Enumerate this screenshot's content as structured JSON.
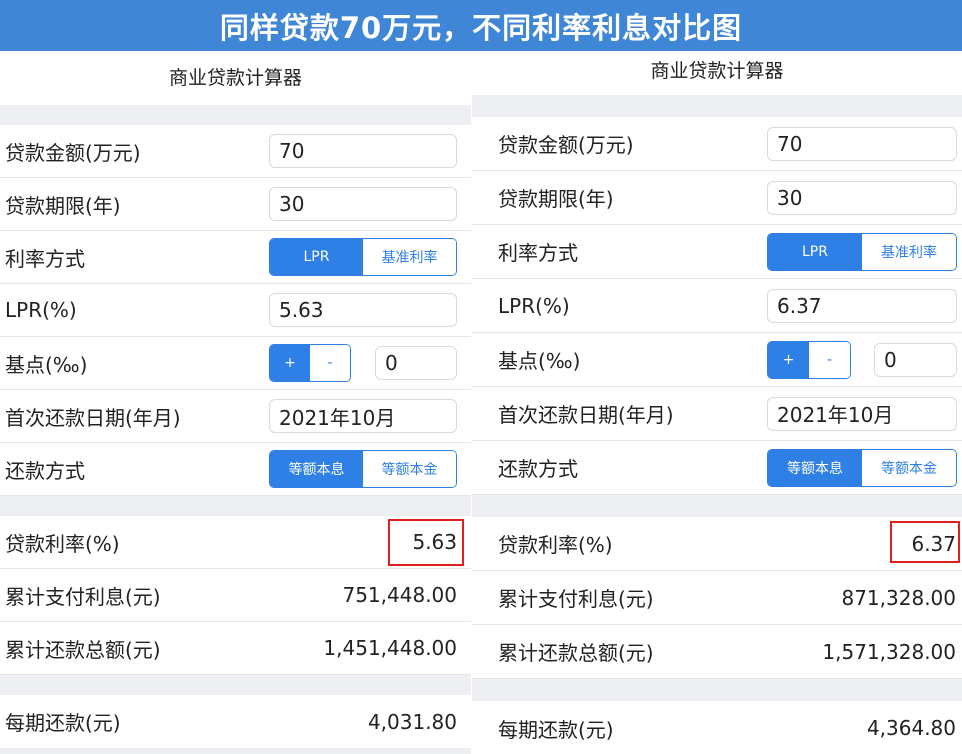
{
  "banner": {
    "title": "同样贷款70万元，不同利率利息对比图"
  },
  "calculators": [
    {
      "title": "商业贷款计算器",
      "loan_amount": {
        "label": "贷款金额(万元)",
        "value": "70"
      },
      "loan_term": {
        "label": "贷款期限(年)",
        "value": "30"
      },
      "rate_mode": {
        "label": "利率方式",
        "options": [
          "LPR",
          "基准利率"
        ],
        "selected": "LPR"
      },
      "lpr": {
        "label": "LPR(%)",
        "value": "5.63"
      },
      "basis_points": {
        "label": "基点(‰)",
        "plus": "+",
        "minus": "-",
        "value": "0"
      },
      "first_payment": {
        "label": "首次还款日期(年月)",
        "value": "2021年10月"
      },
      "repay_method": {
        "label": "还款方式",
        "options": [
          "等额本息",
          "等额本金"
        ],
        "selected": "等额本息"
      },
      "results": {
        "rate": {
          "label": "贷款利率(%)",
          "value": "5.63"
        },
        "total_interest": {
          "label": "累计支付利息(元)",
          "value": "751,448.00"
        },
        "total_repayment": {
          "label": "累计还款总额(元)",
          "value": "1,451,448.00"
        },
        "monthly": {
          "label": "每期还款(元)",
          "value": "4,031.80"
        }
      }
    },
    {
      "title": "商业贷款计算器",
      "loan_amount": {
        "label": "贷款金额(万元)",
        "value": "70"
      },
      "loan_term": {
        "label": "贷款期限(年)",
        "value": "30"
      },
      "rate_mode": {
        "label": "利率方式",
        "options": [
          "LPR",
          "基准利率"
        ],
        "selected": "LPR"
      },
      "lpr": {
        "label": "LPR(%)",
        "value": "6.37"
      },
      "basis_points": {
        "label": "基点(‰)",
        "plus": "+",
        "minus": "-",
        "value": "0"
      },
      "first_payment": {
        "label": "首次还款日期(年月)",
        "value": "2021年10月"
      },
      "repay_method": {
        "label": "还款方式",
        "options": [
          "等额本息",
          "等额本金"
        ],
        "selected": "等额本息"
      },
      "results": {
        "rate": {
          "label": "贷款利率(%)",
          "value": "6.37"
        },
        "total_interest": {
          "label": "累计支付利息(元)",
          "value": "871,328.00"
        },
        "total_repayment": {
          "label": "累计还款总额(元)",
          "value": "1,571,328.00"
        },
        "monthly": {
          "label": "每期还款(元)",
          "value": "4,364.80"
        }
      }
    }
  ],
  "colors": {
    "banner": "#3f86d6",
    "accent": "#2e7fe6",
    "highlight": "#e02020",
    "gap": "#eeeff3"
  }
}
